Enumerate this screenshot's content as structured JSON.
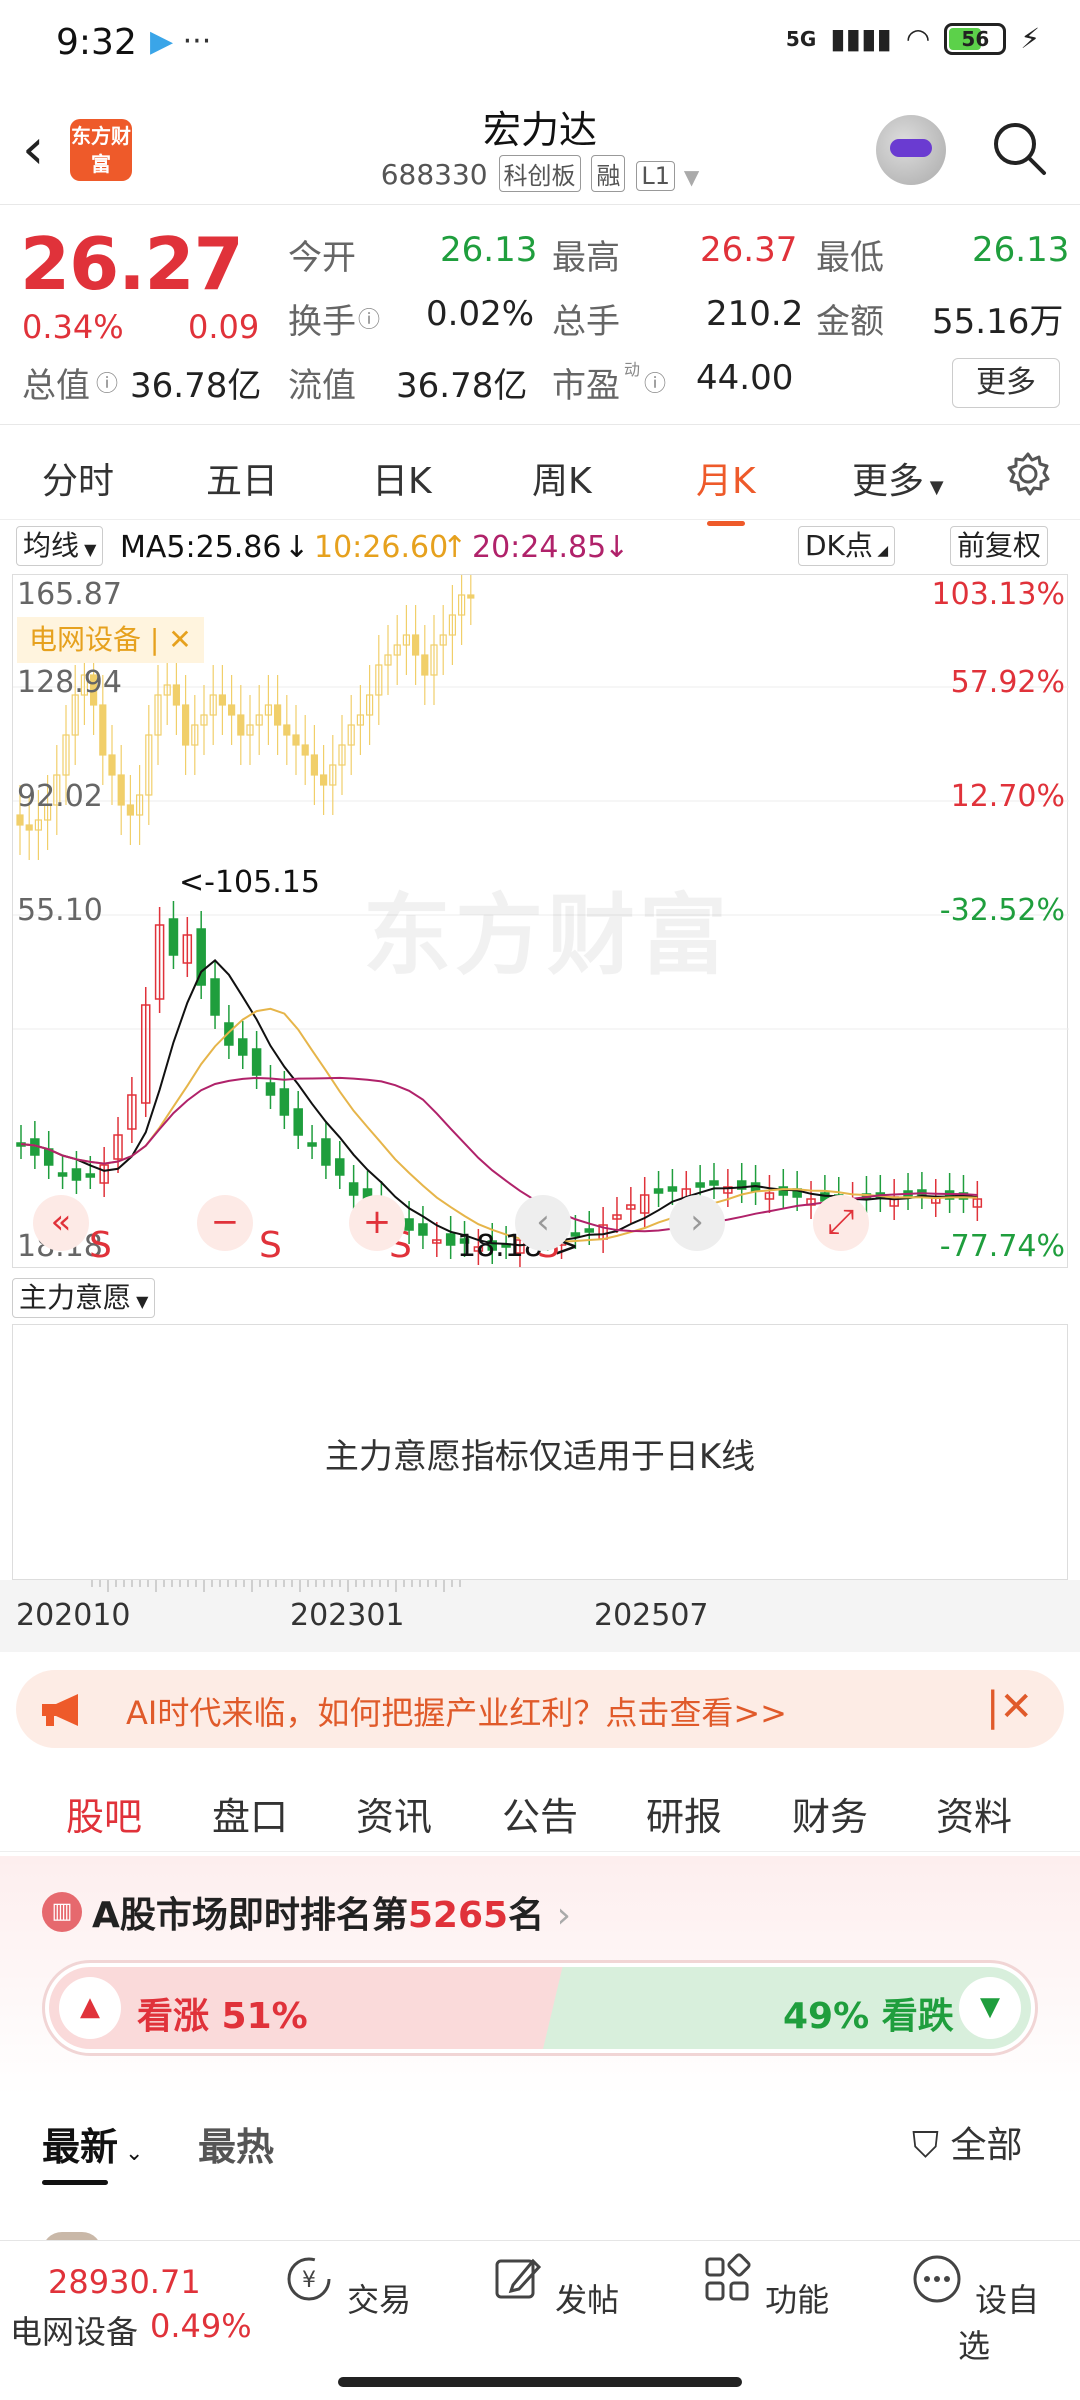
{
  "status_bar": {
    "time": "9:32",
    "extra": "···",
    "network": "5G",
    "battery": "56"
  },
  "header": {
    "logo_text": "东方财富",
    "title": "宏力达",
    "code": "688330",
    "tags": [
      "科创板",
      "融",
      "L1"
    ]
  },
  "quote": {
    "price": "26.27",
    "change_pct": "0.34%",
    "change": "0.09",
    "rows": [
      [
        {
          "label": "今开",
          "value": "26.13",
          "color": "green"
        },
        {
          "label": "最高",
          "value": "26.37",
          "color": "red"
        },
        {
          "label": "最低",
          "value": "26.13",
          "color": "green"
        }
      ],
      [
        {
          "label": "换手",
          "value": "0.02%",
          "color": "dark"
        },
        {
          "label": "总手",
          "value": "210.2",
          "color": "dark"
        },
        {
          "label": "金额",
          "value": "55.16万",
          "color": "dark"
        }
      ],
      [
        {
          "label": "总值",
          "value": "36.78亿",
          "color": "dark"
        },
        {
          "label": "流值",
          "value": "36.78亿",
          "color": "dark"
        },
        {
          "label": "市盈",
          "value": "44.00",
          "color": "dark"
        }
      ]
    ],
    "pe_superscript": "动",
    "more_label": "更多"
  },
  "k_tabs": [
    "分时",
    "五日",
    "日K",
    "周K",
    "月K",
    "更多"
  ],
  "k_active": "月K",
  "ma": {
    "select": "均线",
    "ma5": "MA5:25.86",
    "ma10": "10:26.60",
    "ma20": "20:24.85",
    "dk": "DK点",
    "adjust": "前复权"
  },
  "chart": {
    "sector_tag": "电网设备 |",
    "watermark": "东方财富",
    "y_left": [
      "165.87",
      "128.94",
      "92.02",
      "55.10",
      "18.18"
    ],
    "y_right": [
      "103.13%",
      "57.92%",
      "12.70%",
      "-32.52%",
      "-77.74%"
    ],
    "high_marker": "<-105.15",
    "low_marker": "18.18->",
    "s_marks": [
      "S",
      "S",
      "S",
      "S"
    ],
    "colors": {
      "up": "#e0323a",
      "down": "#1f9e3d",
      "ma5": "#111111",
      "ma10": "#e6b54a",
      "ma20": "#b0226a"
    }
  },
  "indicator": {
    "select": "主力意愿",
    "message": "主力意愿指标仅适用于日K线"
  },
  "dates": [
    "202010",
    "202301",
    "202507"
  ],
  "banner": {
    "text": "AI时代来临，如何把握产业红利？点击查看>>"
  },
  "news_tabs": [
    "股吧",
    "盘口",
    "资讯",
    "公告",
    "研报",
    "财务",
    "资料"
  ],
  "news_active": "股吧",
  "rank": {
    "prefix": "A股市场即时排名第",
    "number": "5265",
    "suffix": "名"
  },
  "vote": {
    "up_label": "看涨 51%",
    "down_label": "49% 看跌"
  },
  "filters": {
    "latest": "最新",
    "hot": "最热",
    "all": "全部"
  },
  "bottom_nav": {
    "index_value": "28930.71",
    "index_name": "电网设备",
    "index_change": "0.49%",
    "items": [
      "交易",
      "发帖",
      "功能",
      "设自选"
    ]
  }
}
